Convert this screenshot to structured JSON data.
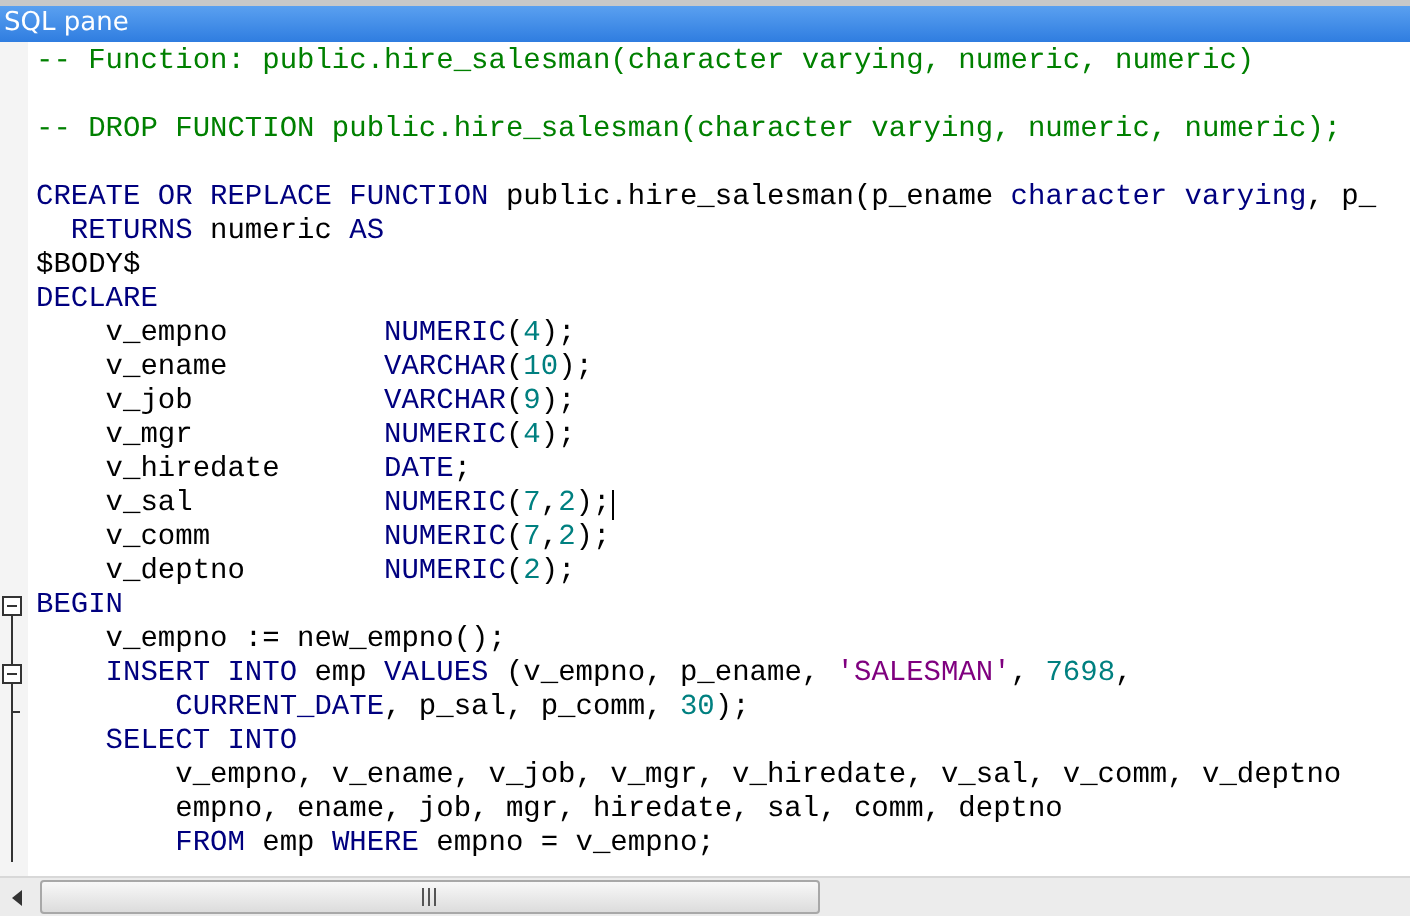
{
  "window": {
    "title": "SQL pane"
  },
  "editor": {
    "blocks": [
      {
        "lines": [
          {
            "tokens": [
              {
                "kind": "comment",
                "text": "-- Function: public.hire_salesman(character varying, numeric, numeric)"
              }
            ]
          }
        ]
      },
      {
        "lines": [
          {
            "tokens": [
              {
                "kind": "comment",
                "text": "-- DROP FUNCTION public.hire_salesman(character varying, numeric, numeric);"
              }
            ]
          }
        ]
      },
      {
        "lines": [
          {
            "tokens": [
              {
                "kind": "keyword",
                "text": "CREATE OR REPLACE FUNCTION"
              },
              {
                "kind": "plain",
                "text": " public.hire_salesman(p_ename "
              },
              {
                "kind": "keyword",
                "text": "character varying"
              },
              {
                "kind": "plain",
                "text": ", p_"
              }
            ]
          },
          {
            "tokens": [
              {
                "kind": "keyword",
                "text": "  RETURNS"
              },
              {
                "kind": "plain",
                "text": " numeric "
              },
              {
                "kind": "keyword",
                "text": "AS"
              }
            ]
          },
          {
            "tokens": [
              {
                "kind": "plain",
                "text": "$BODY$"
              }
            ]
          },
          {
            "tokens": [
              {
                "kind": "keyword",
                "text": "DECLARE"
              }
            ]
          },
          {
            "tokens": [
              {
                "kind": "plain",
                "text": "    v_empno         "
              },
              {
                "kind": "keyword",
                "text": "NUMERIC"
              },
              {
                "kind": "plain",
                "text": "("
              },
              {
                "kind": "number",
                "text": "4"
              },
              {
                "kind": "plain",
                "text": ");"
              }
            ]
          },
          {
            "tokens": [
              {
                "kind": "plain",
                "text": "    v_ename         "
              },
              {
                "kind": "keyword",
                "text": "VARCHAR"
              },
              {
                "kind": "plain",
                "text": "("
              },
              {
                "kind": "number",
                "text": "10"
              },
              {
                "kind": "plain",
                "text": ");"
              }
            ]
          },
          {
            "tokens": [
              {
                "kind": "plain",
                "text": "    v_job           "
              },
              {
                "kind": "keyword",
                "text": "VARCHAR"
              },
              {
                "kind": "plain",
                "text": "("
              },
              {
                "kind": "number",
                "text": "9"
              },
              {
                "kind": "plain",
                "text": ");"
              }
            ]
          },
          {
            "tokens": [
              {
                "kind": "plain",
                "text": "    v_mgr           "
              },
              {
                "kind": "keyword",
                "text": "NUMERIC"
              },
              {
                "kind": "plain",
                "text": "("
              },
              {
                "kind": "number",
                "text": "4"
              },
              {
                "kind": "plain",
                "text": ");"
              }
            ]
          },
          {
            "tokens": [
              {
                "kind": "plain",
                "text": "    v_hiredate      "
              },
              {
                "kind": "keyword",
                "text": "DATE"
              },
              {
                "kind": "plain",
                "text": ";"
              }
            ]
          },
          {
            "tokens": [
              {
                "kind": "plain",
                "text": "    v_sal           "
              },
              {
                "kind": "keyword",
                "text": "NUMERIC"
              },
              {
                "kind": "plain",
                "text": "("
              },
              {
                "kind": "number",
                "text": "7"
              },
              {
                "kind": "plain",
                "text": ","
              },
              {
                "kind": "number",
                "text": "2"
              },
              {
                "kind": "plain",
                "text": ");"
              }
            ],
            "cursor": true
          },
          {
            "tokens": [
              {
                "kind": "plain",
                "text": "    v_comm          "
              },
              {
                "kind": "keyword",
                "text": "NUMERIC"
              },
              {
                "kind": "plain",
                "text": "("
              },
              {
                "kind": "number",
                "text": "7"
              },
              {
                "kind": "plain",
                "text": ","
              },
              {
                "kind": "number",
                "text": "2"
              },
              {
                "kind": "plain",
                "text": ");"
              }
            ]
          },
          {
            "tokens": [
              {
                "kind": "plain",
                "text": "    v_deptno        "
              },
              {
                "kind": "keyword",
                "text": "NUMERIC"
              },
              {
                "kind": "plain",
                "text": "("
              },
              {
                "kind": "number",
                "text": "2"
              },
              {
                "kind": "plain",
                "text": ");"
              }
            ]
          },
          {
            "tokens": [
              {
                "kind": "keyword",
                "text": "BEGIN"
              }
            ],
            "gutter": {
              "kind": "start"
            }
          },
          {
            "tokens": [
              {
                "kind": "plain",
                "text": "    v_empno := new_empno();"
              }
            ],
            "gutter": {
              "kind": "line"
            }
          },
          {
            "tokens": [
              {
                "kind": "keyword",
                "text": "    INSERT INTO"
              },
              {
                "kind": "plain",
                "text": " emp "
              },
              {
                "kind": "keyword",
                "text": "VALUES"
              },
              {
                "kind": "plain",
                "text": " (v_empno, p_ename, "
              },
              {
                "kind": "string",
                "text": "'SALESMAN'"
              },
              {
                "kind": "plain",
                "text": ", "
              },
              {
                "kind": "number",
                "text": "7698"
              },
              {
                "kind": "plain",
                "text": ","
              }
            ],
            "gutter": {
              "kind": "start"
            }
          },
          {
            "tokens": [
              {
                "kind": "keyword",
                "text": "        CURRENT_DATE"
              },
              {
                "kind": "plain",
                "text": ", p_sal, p_comm, "
              },
              {
                "kind": "number",
                "text": "30"
              },
              {
                "kind": "plain",
                "text": ");"
              }
            ],
            "gutter": {
              "kind": "end"
            }
          },
          {
            "tokens": [
              {
                "kind": "keyword",
                "text": "    SELECT INTO"
              }
            ],
            "gutter": {
              "kind": "line"
            }
          },
          {
            "tokens": [
              {
                "kind": "plain",
                "text": "        v_empno, v_ename, v_job, v_mgr, v_hiredate, v_sal, v_comm, v_deptno"
              }
            ],
            "gutter": {
              "kind": "line"
            }
          },
          {
            "tokens": [
              {
                "kind": "plain",
                "text": "        empno, ename, job, mgr, hiredate, sal, comm, deptno"
              }
            ],
            "gutter": {
              "kind": "line"
            }
          },
          {
            "tokens": [
              {
                "kind": "keyword",
                "text": "        FROM"
              },
              {
                "kind": "plain",
                "text": " emp "
              },
              {
                "kind": "keyword",
                "text": "WHERE"
              },
              {
                "kind": "plain",
                "text": " empno = v_empno;"
              }
            ],
            "gutter": {
              "kind": "line"
            }
          }
        ]
      }
    ]
  }
}
